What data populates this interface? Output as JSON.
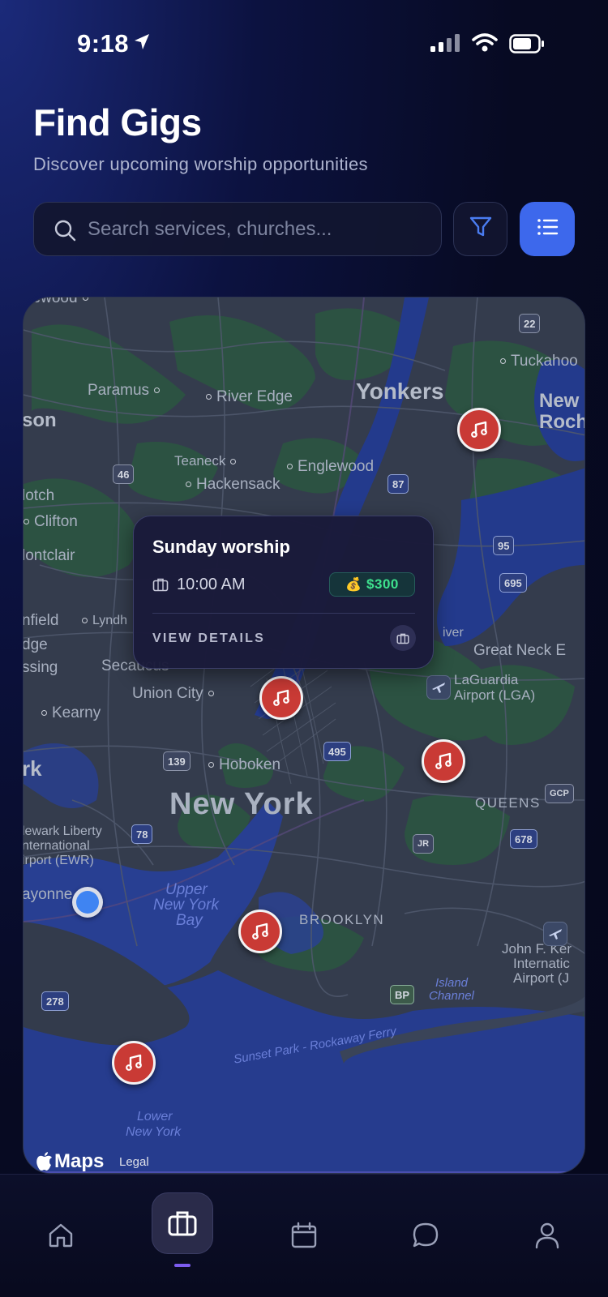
{
  "status_bar": {
    "time": "9:18",
    "icons": [
      "location-arrow-icon",
      "cellular-signal-icon",
      "wifi-icon",
      "battery-icon"
    ]
  },
  "header": {
    "title": "Find Gigs",
    "subtitle": "Discover upcoming worship opportunities"
  },
  "search": {
    "placeholder": "Search services, churches...",
    "value": ""
  },
  "toolbar": {
    "filter_icon": "filter-funnel-icon",
    "list_icon": "list-view-icon"
  },
  "colors": {
    "accent_blue": "#3d68ec",
    "pin_red": "#c93a35",
    "price_green": "#3ee08d",
    "tab_indicator": "#7c5cf0"
  },
  "map": {
    "labels": {
      "edgewood": "gewood",
      "paramus": "Paramus",
      "river_edge": "River Edge",
      "yonkers": "Yonkers",
      "tuckahoe": "Tuckahoo",
      "new_rochelle_1": "New",
      "new_rochelle_2": "Roche",
      "paterson": "son",
      "teaneck": "Teaneck",
      "englewood": "Englewood",
      "hackensack": "Hackensack",
      "nutley": "lotch",
      "clifton": "Clifton",
      "montclair": "lontclair",
      "bloomfield": "nfield",
      "lyndhurst": "Lyndh",
      "ridge": "dge",
      "passing": "ssing",
      "secaucus": "Secaucus",
      "great_neck": "Great Neck E",
      "union_city": "Union City",
      "laguardia_1": "LaGuardia",
      "laguardia_2": "Airport (LGA)",
      "kearny": "Kearny",
      "newark": "rk",
      "hoboken": "Hoboken",
      "new_york": "New York",
      "queens": "QUEENS",
      "ewr_1": "lewark Liberty",
      "ewr_2": "nternational",
      "ewr_3": "irport (EWR)",
      "bayonne": "ayonne",
      "upper_bay_1": "Upper",
      "upper_bay_2": "New York",
      "upper_bay_3": "Bay",
      "brooklyn": "BROOKLYN",
      "jfk_1": "John F. Ker",
      "jfk_2": "Internatic",
      "jfk_3": "Airport (J",
      "island_channel_1": "Island",
      "island_channel_2": "Channel",
      "rockaway_ferry": "Sunset Park - Rockaway Ferry",
      "lower_bay_1": "Lower",
      "lower_bay_2": "New York",
      "river": "iver"
    },
    "road_shields": {
      "r22": "22",
      "r46": "46",
      "r87": "87",
      "r95": "95",
      "r695": "695",
      "r495": "495",
      "r139": "139",
      "r78": "78",
      "r678": "678",
      "gcp": "GCP",
      "jr": "JR",
      "bp": "BP",
      "r278": "278"
    },
    "attribution": {
      "logo": "Maps",
      "legal": "Legal"
    }
  },
  "popup": {
    "title": "Sunday worship",
    "time": "10:00 AM",
    "price_emoji": "💰",
    "price": "$300",
    "details_label": "VIEW DETAILS"
  },
  "tab_bar": {
    "items": [
      {
        "icon": "home-icon",
        "active": false
      },
      {
        "icon": "briefcase-icon",
        "active": true
      },
      {
        "icon": "calendar-icon",
        "active": false
      },
      {
        "icon": "chat-bubble-icon",
        "active": false
      },
      {
        "icon": "profile-icon",
        "active": false
      }
    ]
  }
}
